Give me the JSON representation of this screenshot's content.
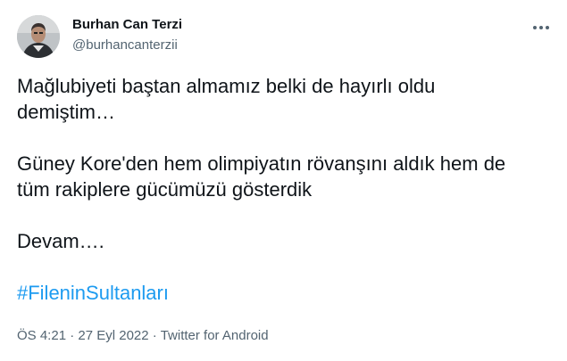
{
  "author": {
    "name": "Burhan Can Terzi",
    "handle": "@burhancanterzii",
    "avatar_icon": "profile-photo"
  },
  "more_icon": "more-horizontal-icon",
  "tweet": {
    "paragraphs": [
      "Mağlubiyeti baştan almamız belki de hayırlı oldu\ndemiştim…",
      "Güney Kore'den hem olimpiyatın rövanşını aldık hem de\ntüm rakiplere gücümüzü gösterdik",
      "Devam…."
    ],
    "hashtag": "#FileninSultanları"
  },
  "meta": {
    "time": "ÖS 4:21",
    "separator": "·",
    "date": "27 Eyl 2022",
    "source": "Twitter for Android"
  },
  "colors": {
    "text": "#0f1419",
    "secondary": "#536471",
    "link": "#1d9bf0"
  }
}
